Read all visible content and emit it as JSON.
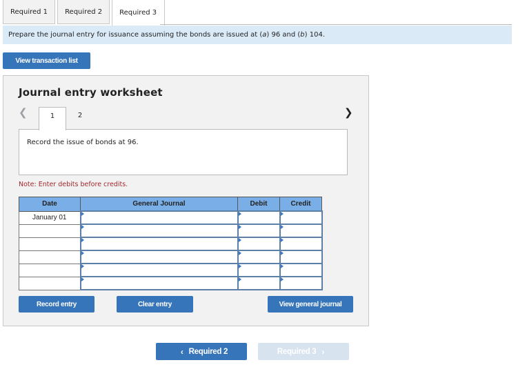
{
  "tabs": [
    {
      "label": "Required 1",
      "active": false
    },
    {
      "label": "Required 2",
      "active": false
    },
    {
      "label": "Required 3",
      "active": true
    }
  ],
  "instruction": "Prepare the journal entry for issuance assuming the bonds are issued at (a) 96 and (b) 104.",
  "view_transaction_list": "View transaction list",
  "worksheet": {
    "title": "Journal entry worksheet",
    "prev_icon": "chevron-left-icon",
    "next_icon": "chevron-right-icon",
    "steps": [
      "1",
      "2"
    ],
    "active_step": "1",
    "description": "Record the issue of bonds at 96.",
    "note": "Note: Enter debits before credits.",
    "table": {
      "headers": [
        "Date",
        "General Journal",
        "Debit",
        "Credit"
      ],
      "rows": [
        {
          "date": "January 01",
          "account": "",
          "debit": "",
          "credit": ""
        },
        {
          "date": "",
          "account": "",
          "debit": "",
          "credit": ""
        },
        {
          "date": "",
          "account": "",
          "debit": "",
          "credit": ""
        },
        {
          "date": "",
          "account": "",
          "debit": "",
          "credit": ""
        },
        {
          "date": "",
          "account": "",
          "debit": "",
          "credit": ""
        },
        {
          "date": "",
          "account": "",
          "debit": "",
          "credit": ""
        }
      ]
    },
    "buttons": {
      "record": "Record entry",
      "clear": "Clear entry",
      "view_general_journal": "View general journal"
    }
  },
  "footer_nav": {
    "prev_label": "Required 2",
    "next_label": "Required 3",
    "prev_chevron": "‹",
    "next_chevron": "›"
  },
  "colors": {
    "button_primary": "#3775ba",
    "button_disabled": "#d8e3f0",
    "table_header": "#7aaee6",
    "banner": "#dbeaf7",
    "note_text": "#a3282b"
  }
}
